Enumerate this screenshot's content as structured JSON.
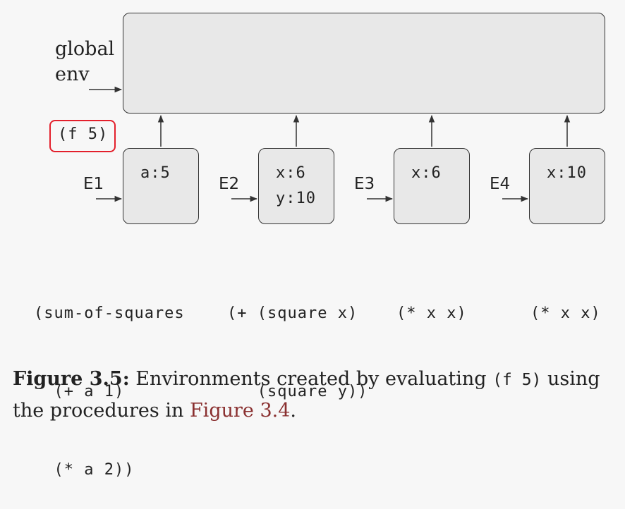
{
  "diagram": {
    "global_env_label": [
      "global",
      "env"
    ],
    "call_label": "(f 5)",
    "frames": [
      {
        "env": "E1",
        "bindings": [
          "a:5"
        ],
        "code": [
          "(sum-of-squares",
          "  (+ a 1)",
          "  (* a 2))"
        ]
      },
      {
        "env": "E2",
        "bindings": [
          "x:6",
          "y:10"
        ],
        "code": [
          "(+ (square x)",
          "   (square y))"
        ]
      },
      {
        "env": "E3",
        "bindings": [
          "x:6"
        ],
        "code": [
          "(* x x)"
        ]
      },
      {
        "env": "E4",
        "bindings": [
          "x:10"
        ],
        "code": [
          "(* x x)"
        ]
      }
    ]
  },
  "caption": {
    "label": "Figure 3.5:",
    "text_before_code": " Environments created by evaluating ",
    "code": "(f 5)",
    "text_after_code": " using the procedures in ",
    "reference": "Figure 3.4",
    "end": "."
  },
  "colors": {
    "highlight": "#e3202c",
    "box_fill": "#e8e8e8",
    "reference_link": "#8a3030"
  }
}
